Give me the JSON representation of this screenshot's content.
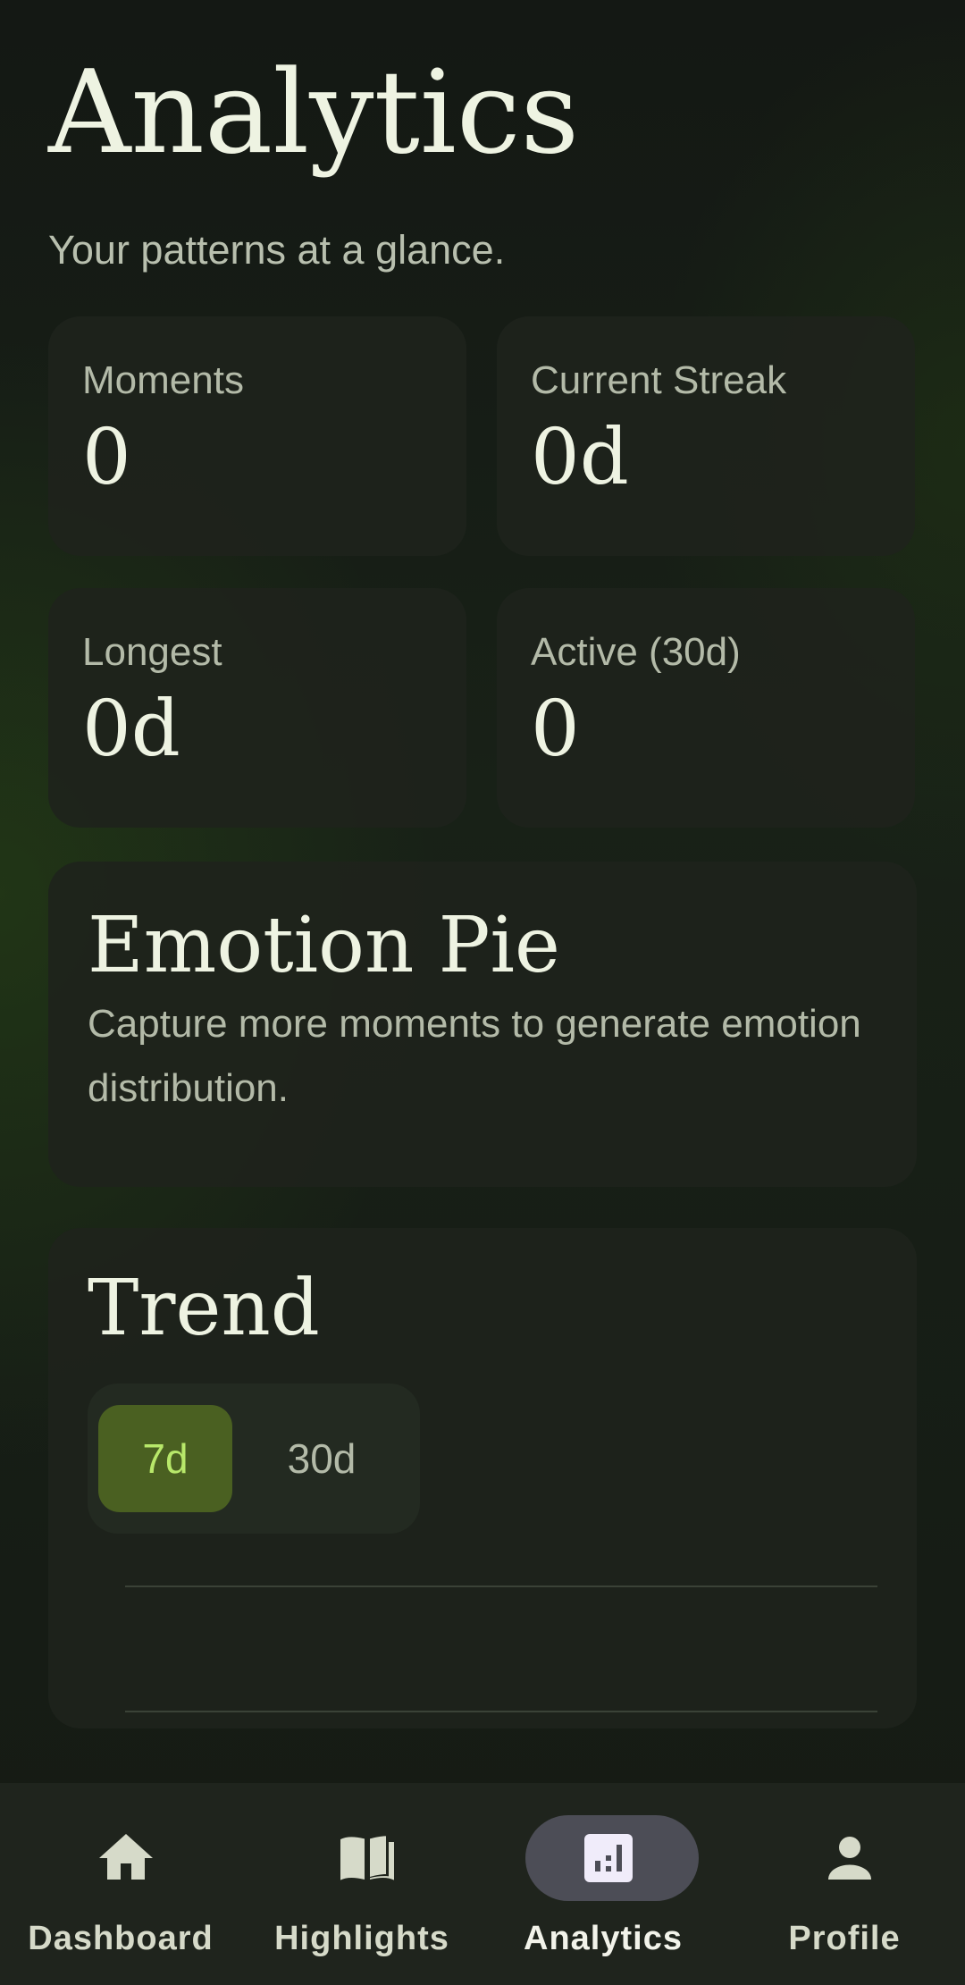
{
  "header": {
    "title": "Analytics",
    "subtitle": "Your patterns at a glance."
  },
  "stats": [
    {
      "label": "Moments",
      "value": "0"
    },
    {
      "label": "Current Streak",
      "value": "0d"
    },
    {
      "label": "Longest",
      "value": "0d"
    },
    {
      "label": "Active (30d)",
      "value": "0"
    }
  ],
  "emotion_pie": {
    "title": "Emotion Pie",
    "message": "Capture more moments to generate emotion distribution."
  },
  "trend": {
    "title": "Trend",
    "ranges": [
      {
        "label": "7d",
        "selected": true
      },
      {
        "label": "30d",
        "selected": false
      }
    ]
  },
  "nav": {
    "items": [
      {
        "label": "Dashboard",
        "icon": "home-icon",
        "active": false
      },
      {
        "label": "Highlights",
        "icon": "book-icon",
        "active": false
      },
      {
        "label": "Analytics",
        "icon": "analytics-icon",
        "active": true
      },
      {
        "label": "Profile",
        "icon": "person-icon",
        "active": false
      }
    ]
  },
  "colors": {
    "background": "#161a15",
    "card": "#1e231c",
    "accent": "#b8e86a",
    "accent_bg": "#4a6021",
    "nav_active_pill": "#4c4d56"
  }
}
